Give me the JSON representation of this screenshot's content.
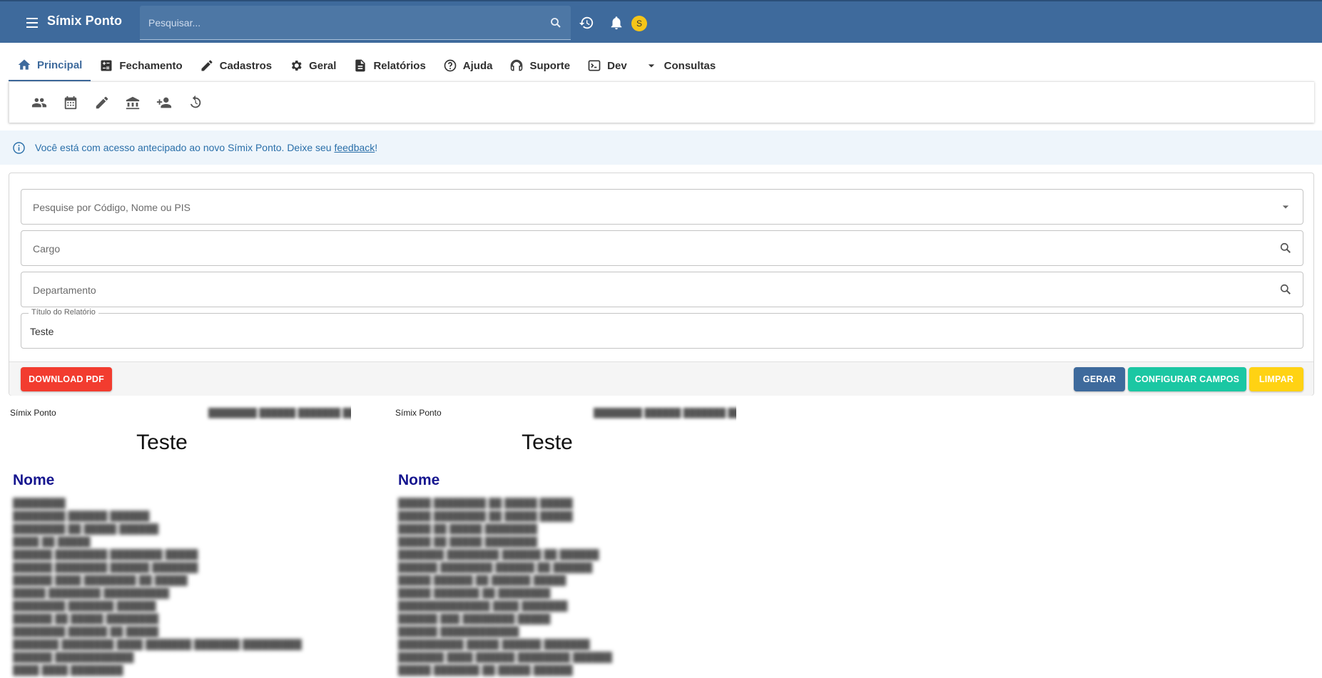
{
  "header": {
    "app_title": "Símix Ponto",
    "search_placeholder": "Pesquisar...",
    "avatar_initial": "S",
    "icons": [
      "menu-icon",
      "search-icon",
      "history-icon",
      "bell-icon"
    ]
  },
  "tabs": [
    {
      "label": "Principal",
      "icon": "home-icon",
      "active": true
    },
    {
      "label": "Fechamento",
      "icon": "calculator-icon"
    },
    {
      "label": "Cadastros",
      "icon": "pencil-icon"
    },
    {
      "label": "Geral",
      "icon": "gear-icon"
    },
    {
      "label": "Relatórios",
      "icon": "document-icon"
    },
    {
      "label": "Ajuda",
      "icon": "help-icon"
    },
    {
      "label": "Suporte",
      "icon": "support-icon"
    },
    {
      "label": "Dev",
      "icon": "terminal-icon"
    },
    {
      "label": "Consultas",
      "icon": "dropdown-icon"
    }
  ],
  "subtoolbar_icons": [
    "people-icon",
    "calendar-icon",
    "edit-icon",
    "bank-icon",
    "add-person-icon",
    "clock-reset-icon"
  ],
  "banner": {
    "text": "Você está com acesso antecipado ao novo Símix Ponto. Deixe seu ",
    "link": "feedback",
    "suffix": "!"
  },
  "form": {
    "employee_placeholder": "Pesquise por Código, Nome ou PIS",
    "cargo_placeholder": "Cargo",
    "departamento_placeholder": "Departamento",
    "titulo_label": "Título do Relatório",
    "titulo_value": "Teste"
  },
  "buttons": {
    "download_pdf": "DOWNLOAD PDF",
    "gerar": "GERAR",
    "configurar": "CONFIGURAR CAMPOS",
    "limpar": "LIMPAR"
  },
  "report": {
    "brand": "Símix Ponto",
    "date": "████████ ██████ ███████ ████",
    "title": "Teste",
    "column_header": "Nome",
    "left_names": [
      "████████",
      "████████ ██████ ██████",
      "████████ ██ █████ ██████",
      "████ ██ █████",
      "██████ ████████ ████████ █████",
      "██████ ████████ ██████ ███████",
      "██████ ████ ████████ ██ █████",
      "█████ ████████ ██████████",
      "████████ ███████ ██████",
      "██████ ██ █████ ████████",
      "████████ ██████ ██ █████",
      "███████ ████████ ████ ███████ ███████ █████████",
      "██████ ████████████",
      "████ ████ ████████"
    ],
    "right_names": [
      "█████ ████████ ██ █████ █████",
      "█████ ████████ ██ █████ █████",
      "█████ ██ █████ ████████",
      "█████ ██ █████ ████████",
      "███████ ████████ ██████ ██ ██████",
      "██████ ████████ ██████ ██ ██████",
      "█████ ██████ ██ ██████ █████",
      "█████ ███████ ██ ████████",
      "██████████████ ████ ███████",
      "██████ ███ ████████ █████",
      "██████ ████████████",
      "██████████ █████ ██████ ███████",
      "███████ ████ ██████ ████████ ██████",
      "█████ ███████ ██ █████ ██████"
    ]
  },
  "colors": {
    "brand_bar": "#3e6a9c",
    "pdf_button": "#f23c2f",
    "config_button": "#1bc7a3",
    "limpar_button": "#ffd213",
    "report_header": "#16168f",
    "banner_text": "#2a6fa9"
  }
}
